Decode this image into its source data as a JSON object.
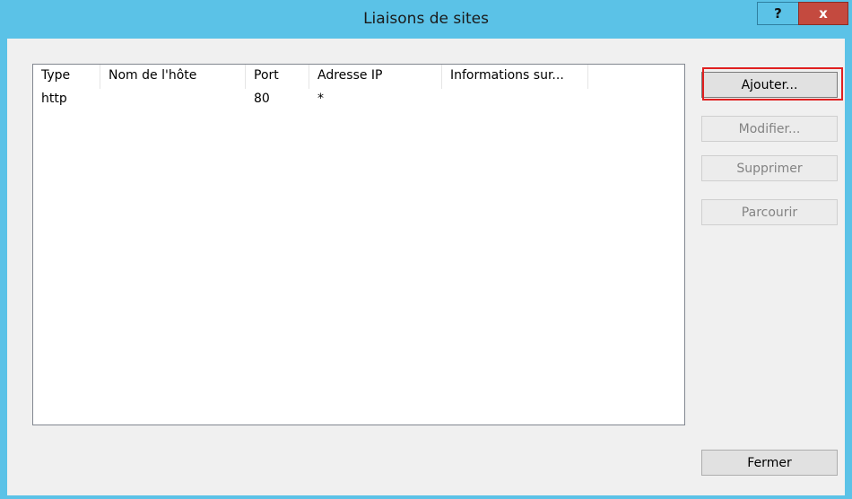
{
  "window": {
    "title": "Liaisons de sites",
    "help_label": "?",
    "close_label": "x"
  },
  "bindings": {
    "columns": [
      "Type",
      "Nom de l'hôte",
      "Port",
      "Adresse IP",
      "Informations sur..."
    ],
    "rows": [
      {
        "type": "http",
        "host": "",
        "port": "80",
        "ip": "*",
        "info": ""
      }
    ]
  },
  "buttons": {
    "add": "Ajouter...",
    "edit": "Modifier...",
    "remove": "Supprimer",
    "browse": "Parcourir",
    "close": "Fermer"
  },
  "colors": {
    "titlebar": "#5bc2e7",
    "highlight": "#e02020",
    "close_button": "#c44a3f"
  }
}
